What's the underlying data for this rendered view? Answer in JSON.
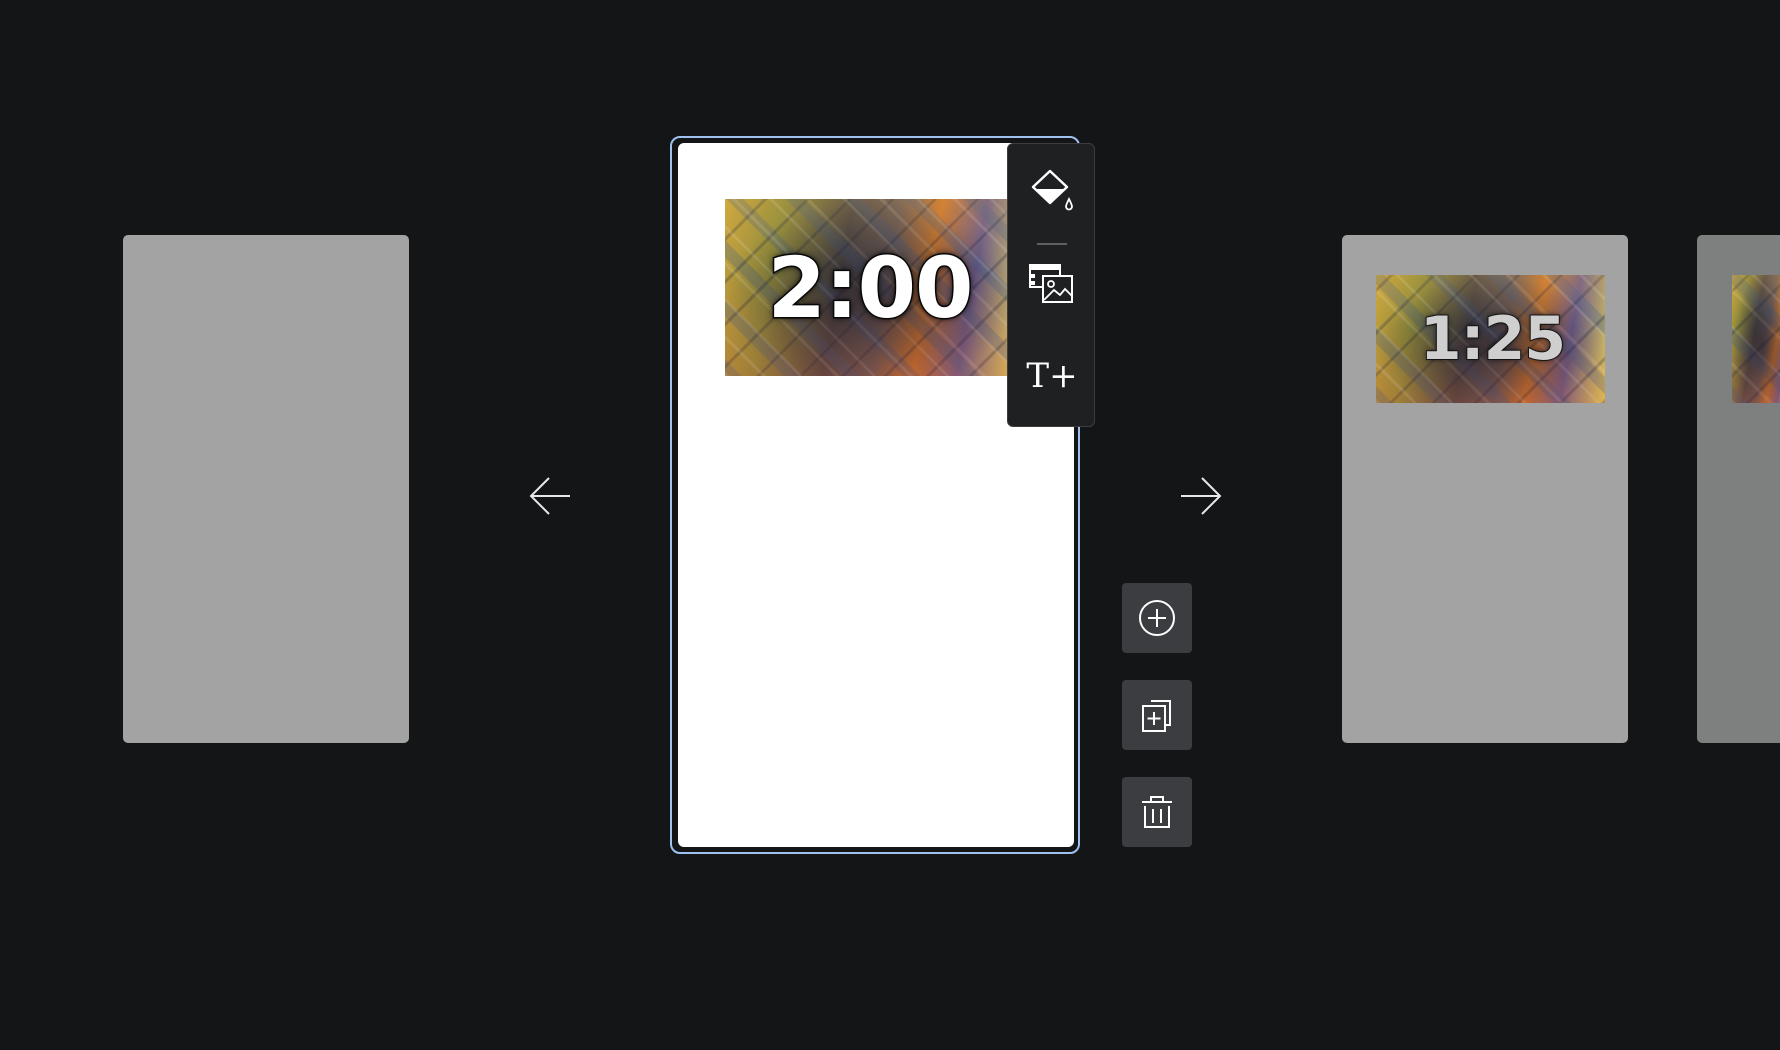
{
  "slides": {
    "current": {
      "timer_text": "2:00"
    },
    "next": {
      "timer_text": "1:25"
    }
  },
  "toolbar": {
    "icons": [
      "paint-bucket-icon",
      "media-library-icon",
      "add-text-icon"
    ],
    "add_text_glyph": "T+"
  },
  "navigation": {
    "prev_icon": "arrow-left-icon",
    "next_icon": "arrow-right-icon"
  },
  "actions": {
    "icons": [
      "add-circle-icon",
      "duplicate-icon",
      "trash-icon"
    ]
  },
  "colors": {
    "background": "#141517",
    "selection_border": "#9ec1f0",
    "button_bg": "#3b3d40",
    "toolbar_bg": "#1f2022"
  }
}
